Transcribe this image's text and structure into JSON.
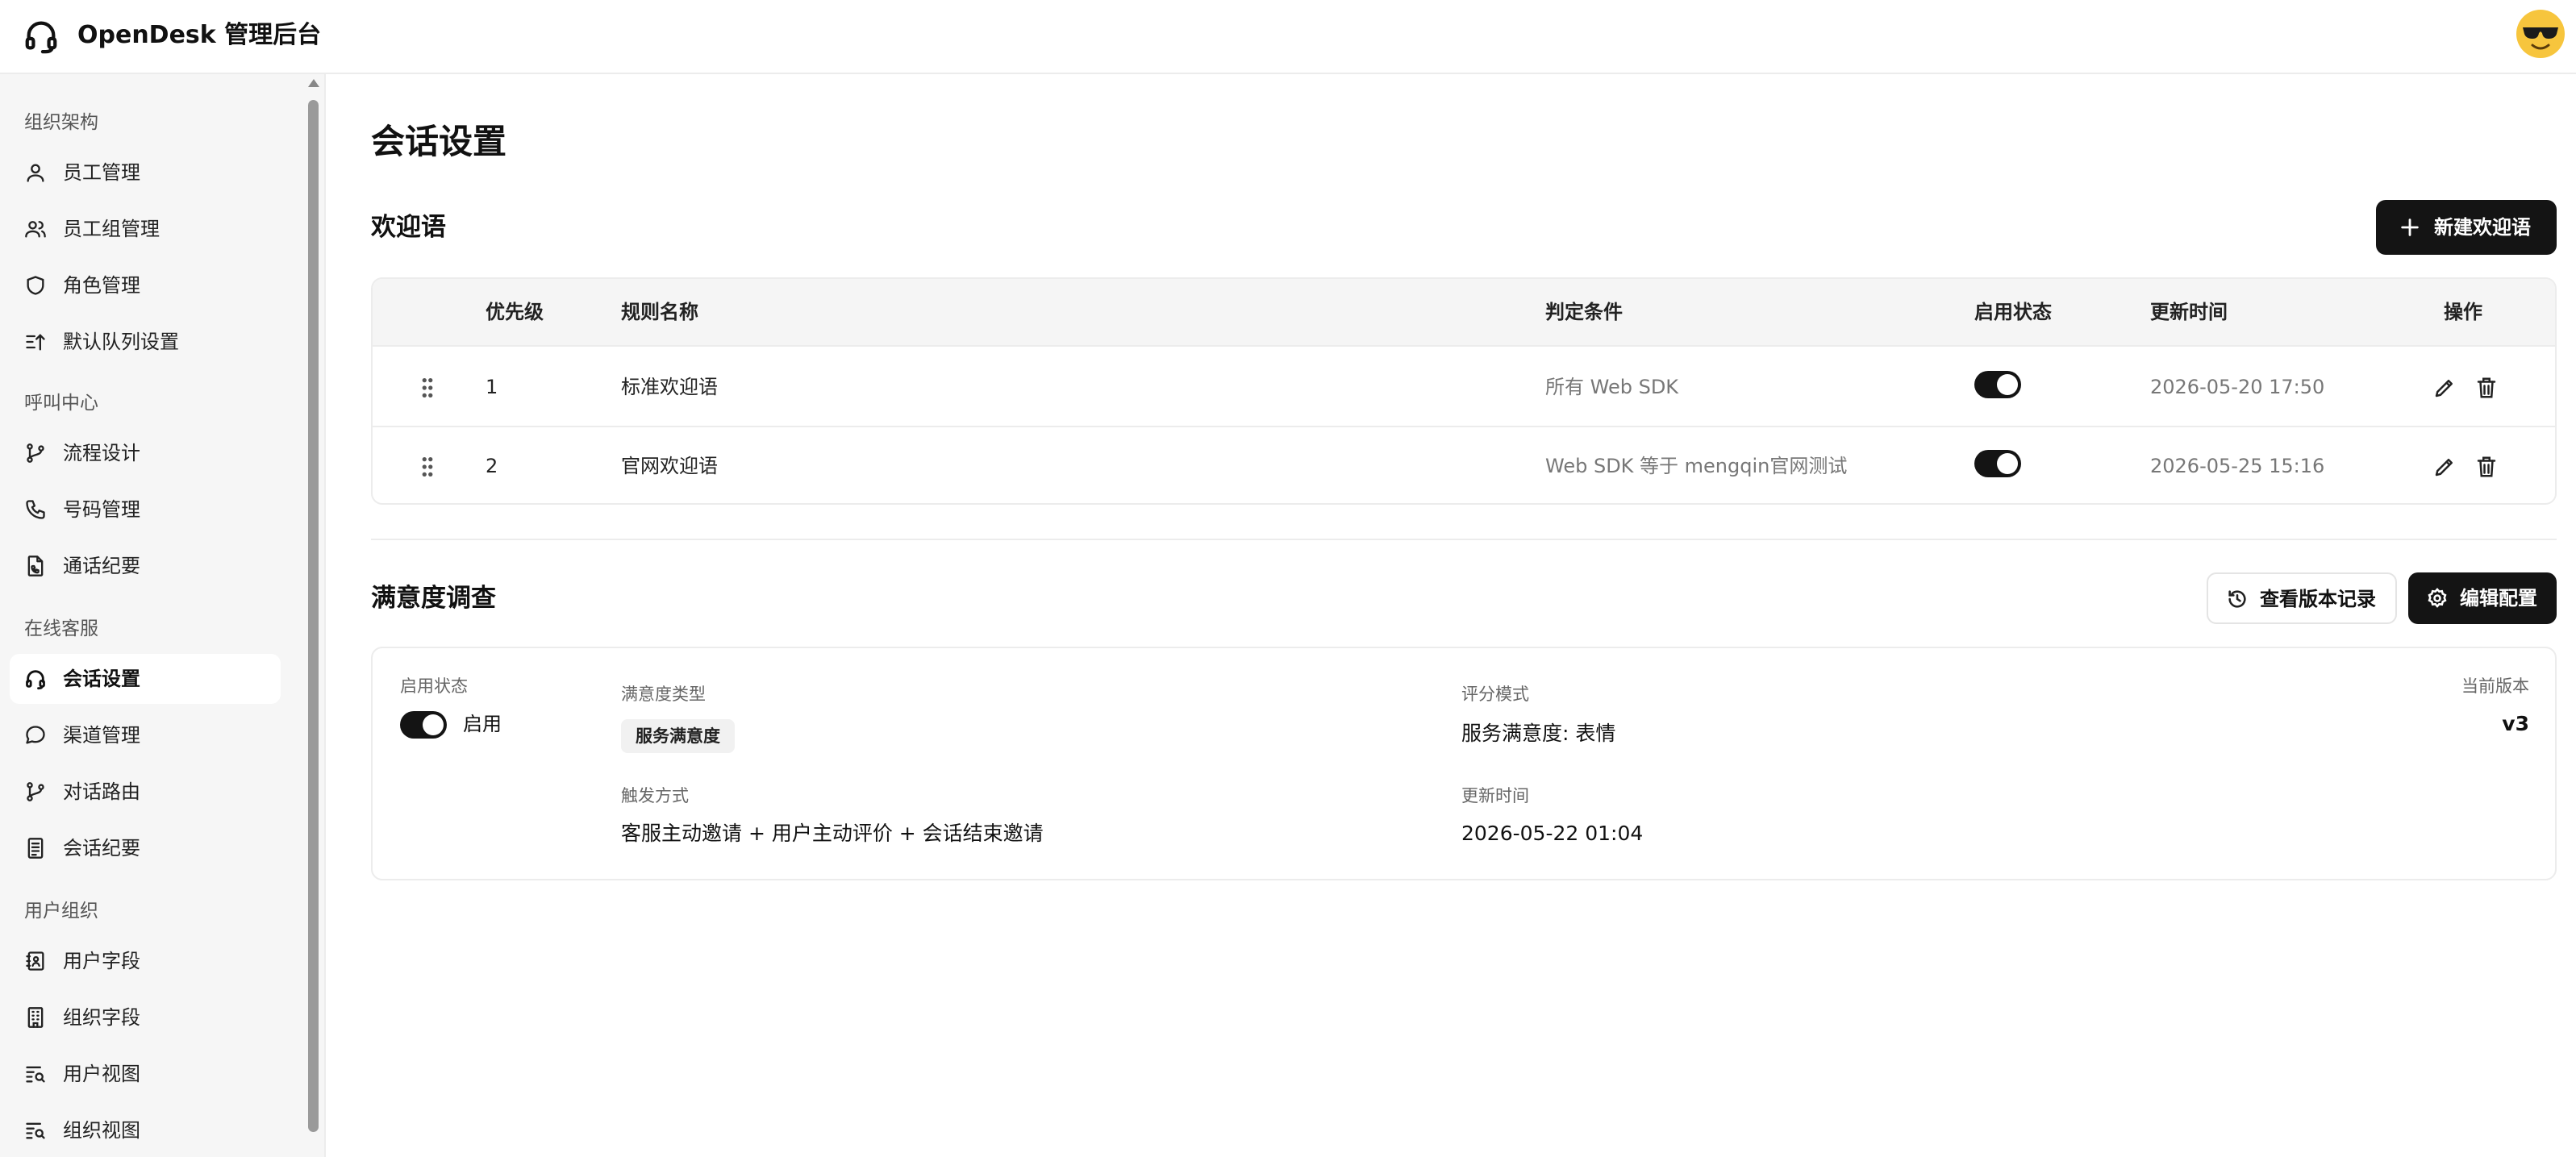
{
  "app": {
    "title": "OpenDesk 管理后台",
    "avatar_emoji": "😎"
  },
  "sidebar": {
    "sections": [
      {
        "title": "组织架构",
        "items": [
          {
            "label": "员工管理",
            "icon": "user-icon"
          },
          {
            "label": "员工组管理",
            "icon": "users-icon"
          },
          {
            "label": "角色管理",
            "icon": "shield-icon"
          },
          {
            "label": "默认队列设置",
            "icon": "queue-sort-icon"
          }
        ]
      },
      {
        "title": "呼叫中心",
        "items": [
          {
            "label": "流程设计",
            "icon": "flow-branch-icon"
          },
          {
            "label": "号码管理",
            "icon": "phone-icon"
          },
          {
            "label": "通话纪要",
            "icon": "call-note-icon"
          }
        ]
      },
      {
        "title": "在线客服",
        "items": [
          {
            "label": "会话设置",
            "icon": "headset-icon",
            "active": true
          },
          {
            "label": "渠道管理",
            "icon": "chat-bubble-icon"
          },
          {
            "label": "对话路由",
            "icon": "route-branch-icon"
          },
          {
            "label": "会话纪要",
            "icon": "document-icon"
          }
        ]
      },
      {
        "title": "用户组织",
        "items": [
          {
            "label": "用户字段",
            "icon": "contact-book-icon"
          },
          {
            "label": "组织字段",
            "icon": "building-icon"
          },
          {
            "label": "用户视图",
            "icon": "list-search-icon"
          },
          {
            "label": "组织视图",
            "icon": "list-search-icon"
          }
        ]
      }
    ]
  },
  "main": {
    "page_title": "会话设置",
    "greeting": {
      "heading": "欢迎语",
      "new_button": "新建欢迎语",
      "columns": [
        "优先级",
        "规则名称",
        "判定条件",
        "启用状态",
        "更新时间",
        "操作"
      ],
      "rows": [
        {
          "priority": "1",
          "name": "标准欢迎语",
          "condition": "所有 Web SDK",
          "enabled": true,
          "updated": "2026-05-20 17:50"
        },
        {
          "priority": "2",
          "name": "官网欢迎语",
          "condition": "Web SDK 等于 mengqin官网测试",
          "enabled": true,
          "updated": "2026-05-25 15:16"
        }
      ]
    },
    "survey": {
      "heading": "满意度调查",
      "history_button": "查看版本记录",
      "edit_button": "编辑配置",
      "status_label": "启用状态",
      "status_value": "启用",
      "enabled": true,
      "type_label": "满意度类型",
      "type_value": "服务满意度",
      "mode_label": "评分模式",
      "mode_value": "服务满意度: 表情",
      "version_label": "当前版本",
      "version_value": "v3",
      "trigger_label": "触发方式",
      "trigger_value": "客服主动邀请 + 用户主动评价 + 会话结束邀请",
      "updated_label": "更新时间",
      "updated_value": "2026-05-22 01:04"
    }
  },
  "colors": {
    "accent": "#141414",
    "sidebar_bg": "#f6f6f6",
    "border": "#ececec",
    "muted_text": "#777777"
  }
}
